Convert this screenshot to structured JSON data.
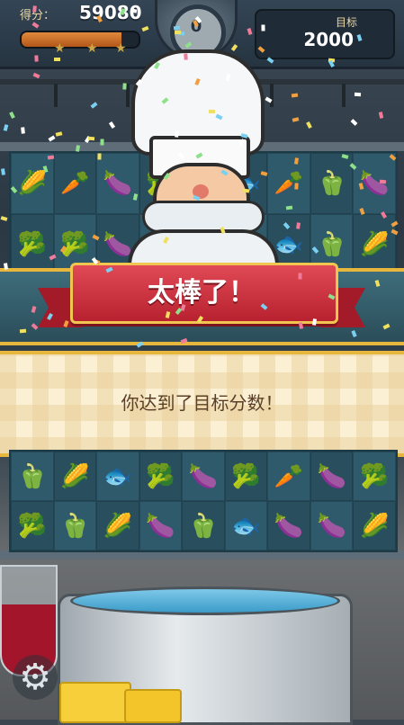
{
  "hud": {
    "score_label": "得分：",
    "score_value": "59080",
    "progress_fraction": 0.85,
    "stars": [
      "★",
      "★",
      "★"
    ],
    "timer_value": "0",
    "target_label": "目标",
    "target_value": "2000"
  },
  "banner": {
    "title": "太棒了！",
    "message": "你达到了目标分数！"
  },
  "board_top": [
    [
      "🌽",
      "🥕",
      "🍆",
      "🥦",
      "🥦",
      "🐟",
      "🥕",
      "🫑",
      "🍆"
    ],
    [
      "🥦",
      "🥦",
      "🍆",
      "🌽",
      "🫑",
      "🥕",
      "🐟",
      "🫑",
      "🌽"
    ]
  ],
  "board_bottom": [
    [
      "🫑",
      "🌽",
      "🐟",
      "🥦",
      "🍆",
      "🥦",
      "🥕",
      "🍆",
      "🥦"
    ],
    [
      "🥦",
      "🫑",
      "🌽",
      "🍆",
      "🫑",
      "🐟",
      "🍆",
      "🍆",
      "🌽"
    ]
  ],
  "icons": {
    "settings": "gear-icon",
    "star": "star-icon",
    "timer": "timer-icon"
  },
  "colors": {
    "ribbon": "#c9283a",
    "gold_border": "#e7b63c",
    "message_text": "#5a3f26"
  }
}
